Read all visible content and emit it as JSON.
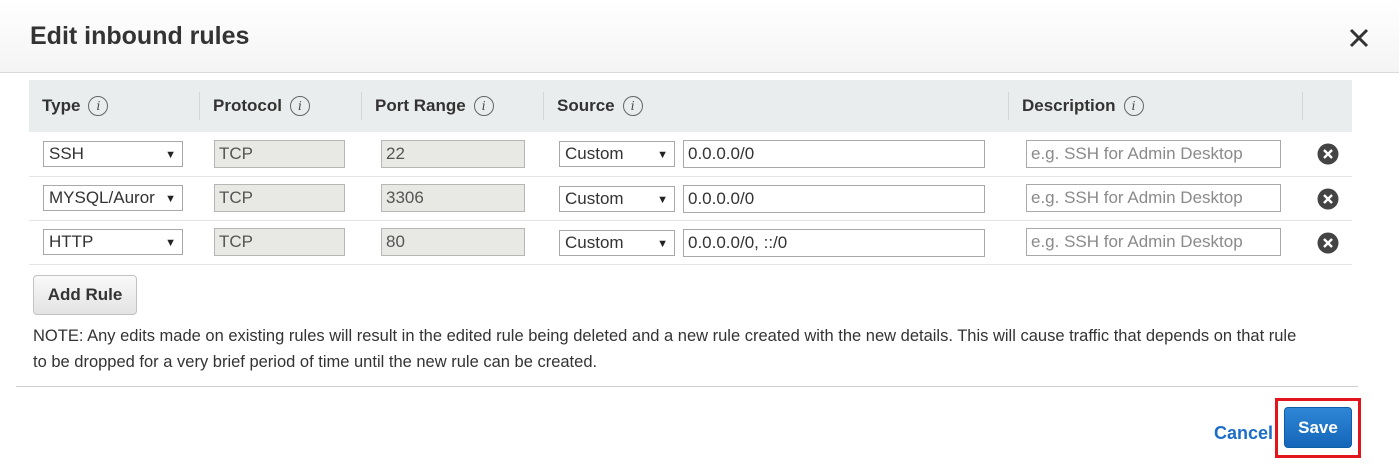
{
  "modal": {
    "title": "Edit inbound rules"
  },
  "table": {
    "headers": {
      "type": "Type",
      "protocol": "Protocol",
      "port_range": "Port Range",
      "source": "Source",
      "description": "Description"
    },
    "rows": [
      {
        "type": "SSH",
        "protocol": "TCP",
        "port_range": "22",
        "source_type": "Custom",
        "source_value": "0.0.0.0/0",
        "description_placeholder": "e.g. SSH for Admin Desktop"
      },
      {
        "type": "MYSQL/Auror",
        "protocol": "TCP",
        "port_range": "3306",
        "source_type": "Custom",
        "source_value": "0.0.0.0/0",
        "description_placeholder": "e.g. SSH for Admin Desktop"
      },
      {
        "type": "HTTP",
        "protocol": "TCP",
        "port_range": "80",
        "source_type": "Custom",
        "source_value": "0.0.0.0/0, ::/0",
        "description_placeholder": "e.g. SSH for Admin Desktop"
      }
    ]
  },
  "actions": {
    "add_rule": "Add Rule",
    "cancel": "Cancel",
    "save": "Save"
  },
  "note": "NOTE: Any edits made on existing rules will result in the edited rule being deleted and a new rule created with the new details. This will cause traffic that depends on that rule to be dropped for a very brief period of time until the new rule can be created.",
  "icons": {
    "close": "close-icon",
    "info": "info-icon",
    "remove": "remove-rule-icon",
    "dropdown": "dropdown-arrow-icon"
  },
  "colors": {
    "link_blue": "#1c6dc7",
    "save_blue": "#1a6fc4",
    "highlight_red": "#e3151a",
    "header_gray": "#eaeded"
  }
}
